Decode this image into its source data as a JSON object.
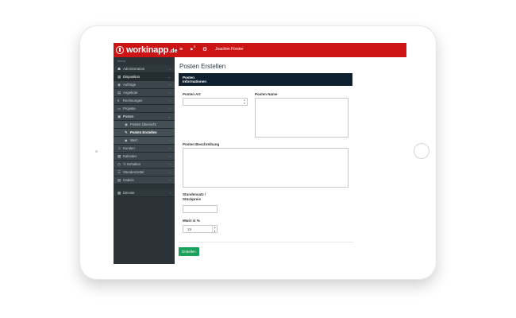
{
  "app": {
    "brand_name": "workinapp",
    "brand_tld": ".de",
    "accent_color": "#cc1414",
    "button_color": "#1aa25a"
  },
  "topbar": {
    "menu_icon": "hamburger-icon",
    "notifications_badge": "5",
    "user_name": "Joachim Förster"
  },
  "sidebar": {
    "section_label": "Menü",
    "items": [
      {
        "label": "Administration",
        "icon": "users-cog-icon"
      },
      {
        "label": "Disposition",
        "icon": "calendar-icon"
      },
      {
        "label": "Aufträge",
        "icon": "eye-icon"
      },
      {
        "label": "Angebote",
        "icon": "file-icon"
      },
      {
        "label": "Rechnungen",
        "icon": "euro-icon"
      },
      {
        "label": "Projekte",
        "icon": "folder-icon"
      },
      {
        "label": "Posten",
        "icon": "cubes-icon"
      },
      {
        "label": "Posten Übersicht",
        "icon": "eye-icon"
      },
      {
        "label": "Posten Erstellen",
        "icon": "pencil-icon"
      },
      {
        "label": "Wert",
        "icon": "tag-icon"
      },
      {
        "label": "Kunden",
        "icon": "users-icon"
      },
      {
        "label": "Kalender",
        "icon": "calendar-icon"
      },
      {
        "label": "½ Gehalten",
        "icon": "clock-icon"
      },
      {
        "label": "Stundenzettel",
        "icon": "list-icon"
      },
      {
        "label": "Galerie",
        "icon": "image-icon"
      },
      {
        "label": "Dienste",
        "icon": "briefcase-icon"
      }
    ]
  },
  "main": {
    "page_title": "Posten Erstellen",
    "panel_title_line1": "Posten",
    "panel_title_line2": "Informationen",
    "fields": {
      "posten_art_label": "Posten Art",
      "posten_art_value": "",
      "posten_name_label": "Posten Name",
      "posten_name_value": "",
      "beschreibung_label": "Posten Beschreibung",
      "beschreibung_value": "",
      "stundensatz_label_line1": "Stundensatz /",
      "stundensatz_label_line2": "Stückpreis",
      "stundensatz_value": "",
      "mwst_label": "Mwst in %",
      "mwst_value": "19"
    },
    "submit_label": "Erstellen"
  }
}
